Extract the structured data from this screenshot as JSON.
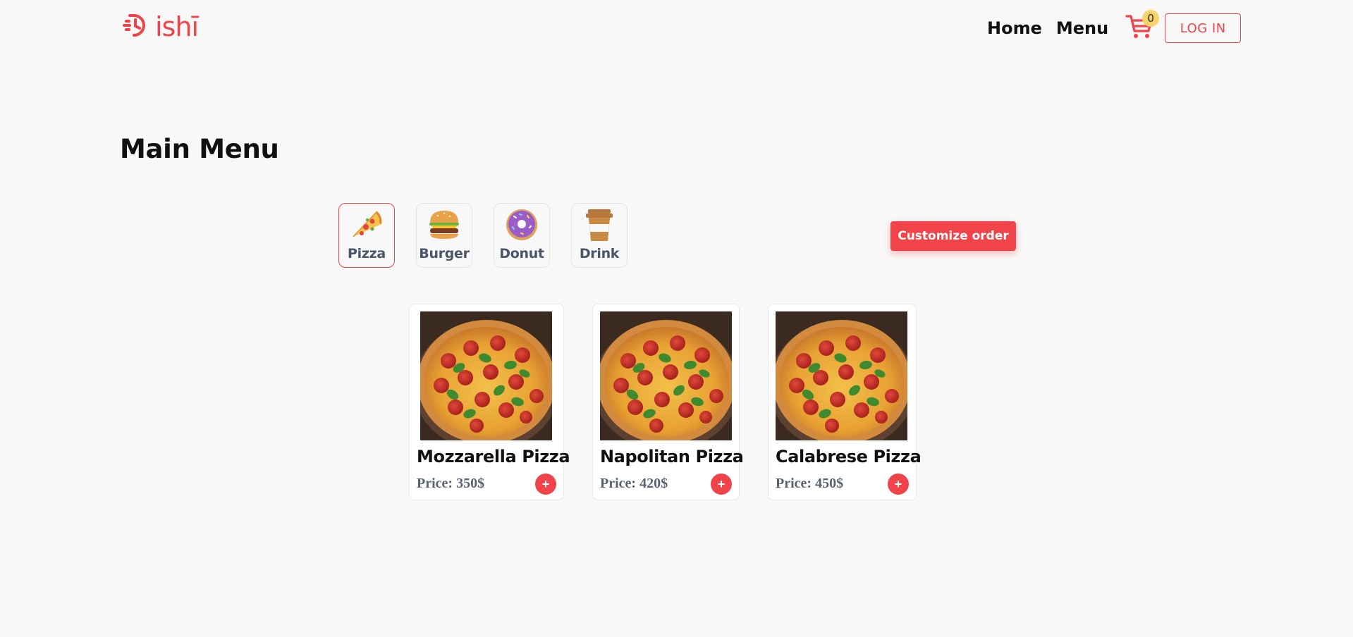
{
  "brand": {
    "name": "ishī",
    "color": "#f0434a",
    "icon": "clock-d-logo-icon"
  },
  "nav": {
    "home": "Home",
    "menu": "Menu",
    "cart_icon": "shopping-cart-icon",
    "cart_count": "0",
    "login": "LOG IN"
  },
  "page_title": "Main Menu",
  "categories": [
    {
      "label": "Pizza",
      "icon": "pizza-slice-icon",
      "active": true
    },
    {
      "label": "Burger",
      "icon": "burger-icon",
      "active": false
    },
    {
      "label": "Donut",
      "icon": "donut-icon",
      "active": false
    },
    {
      "label": "Drink",
      "icon": "coffee-cup-icon",
      "active": false
    }
  ],
  "customize_button": "Customize order",
  "products": [
    {
      "name": "Mozzarella Pizza",
      "price": "Price: 350$",
      "add": "+"
    },
    {
      "name": "Napolitan Pizza",
      "price": "Price: 420$",
      "add": "+"
    },
    {
      "name": "Calabrese Pizza",
      "price": "Price: 450$",
      "add": "+"
    }
  ],
  "colors": {
    "accent": "#f0434a",
    "badge": "#f7d46a",
    "background": "#f8f8f8",
    "muted_text": "#5a6270"
  }
}
